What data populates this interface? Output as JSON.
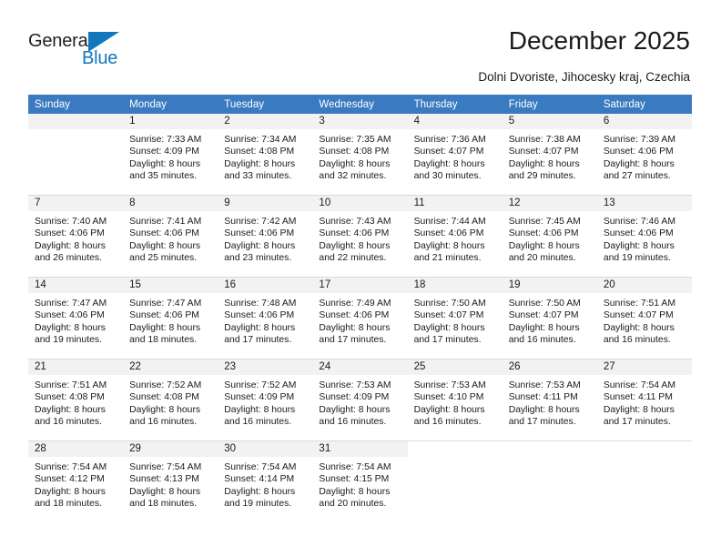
{
  "logo": {
    "text_top": "General",
    "text_bottom": "Blue",
    "accent_color": "#1277bd"
  },
  "header": {
    "title": "December 2025",
    "subtitle": "Dolni Dvoriste, Jihocesky kraj, Czechia"
  },
  "calendar": {
    "header_bg": "#3a7ac0",
    "daynum_bg": "#f2f2f2",
    "weekday_headers": [
      "Sunday",
      "Monday",
      "Tuesday",
      "Wednesday",
      "Thursday",
      "Friday",
      "Saturday"
    ],
    "weeks": [
      [
        {
          "day": "",
          "sunrise": "",
          "sunset": "",
          "daylight_line1": "",
          "daylight_line2": ""
        },
        {
          "day": "1",
          "sunrise": "Sunrise: 7:33 AM",
          "sunset": "Sunset: 4:09 PM",
          "daylight_line1": "Daylight: 8 hours",
          "daylight_line2": "and 35 minutes."
        },
        {
          "day": "2",
          "sunrise": "Sunrise: 7:34 AM",
          "sunset": "Sunset: 4:08 PM",
          "daylight_line1": "Daylight: 8 hours",
          "daylight_line2": "and 33 minutes."
        },
        {
          "day": "3",
          "sunrise": "Sunrise: 7:35 AM",
          "sunset": "Sunset: 4:08 PM",
          "daylight_line1": "Daylight: 8 hours",
          "daylight_line2": "and 32 minutes."
        },
        {
          "day": "4",
          "sunrise": "Sunrise: 7:36 AM",
          "sunset": "Sunset: 4:07 PM",
          "daylight_line1": "Daylight: 8 hours",
          "daylight_line2": "and 30 minutes."
        },
        {
          "day": "5",
          "sunrise": "Sunrise: 7:38 AM",
          "sunset": "Sunset: 4:07 PM",
          "daylight_line1": "Daylight: 8 hours",
          "daylight_line2": "and 29 minutes."
        },
        {
          "day": "6",
          "sunrise": "Sunrise: 7:39 AM",
          "sunset": "Sunset: 4:06 PM",
          "daylight_line1": "Daylight: 8 hours",
          "daylight_line2": "and 27 minutes."
        }
      ],
      [
        {
          "day": "7",
          "sunrise": "Sunrise: 7:40 AM",
          "sunset": "Sunset: 4:06 PM",
          "daylight_line1": "Daylight: 8 hours",
          "daylight_line2": "and 26 minutes."
        },
        {
          "day": "8",
          "sunrise": "Sunrise: 7:41 AM",
          "sunset": "Sunset: 4:06 PM",
          "daylight_line1": "Daylight: 8 hours",
          "daylight_line2": "and 25 minutes."
        },
        {
          "day": "9",
          "sunrise": "Sunrise: 7:42 AM",
          "sunset": "Sunset: 4:06 PM",
          "daylight_line1": "Daylight: 8 hours",
          "daylight_line2": "and 23 minutes."
        },
        {
          "day": "10",
          "sunrise": "Sunrise: 7:43 AM",
          "sunset": "Sunset: 4:06 PM",
          "daylight_line1": "Daylight: 8 hours",
          "daylight_line2": "and 22 minutes."
        },
        {
          "day": "11",
          "sunrise": "Sunrise: 7:44 AM",
          "sunset": "Sunset: 4:06 PM",
          "daylight_line1": "Daylight: 8 hours",
          "daylight_line2": "and 21 minutes."
        },
        {
          "day": "12",
          "sunrise": "Sunrise: 7:45 AM",
          "sunset": "Sunset: 4:06 PM",
          "daylight_line1": "Daylight: 8 hours",
          "daylight_line2": "and 20 minutes."
        },
        {
          "day": "13",
          "sunrise": "Sunrise: 7:46 AM",
          "sunset": "Sunset: 4:06 PM",
          "daylight_line1": "Daylight: 8 hours",
          "daylight_line2": "and 19 minutes."
        }
      ],
      [
        {
          "day": "14",
          "sunrise": "Sunrise: 7:47 AM",
          "sunset": "Sunset: 4:06 PM",
          "daylight_line1": "Daylight: 8 hours",
          "daylight_line2": "and 19 minutes."
        },
        {
          "day": "15",
          "sunrise": "Sunrise: 7:47 AM",
          "sunset": "Sunset: 4:06 PM",
          "daylight_line1": "Daylight: 8 hours",
          "daylight_line2": "and 18 minutes."
        },
        {
          "day": "16",
          "sunrise": "Sunrise: 7:48 AM",
          "sunset": "Sunset: 4:06 PM",
          "daylight_line1": "Daylight: 8 hours",
          "daylight_line2": "and 17 minutes."
        },
        {
          "day": "17",
          "sunrise": "Sunrise: 7:49 AM",
          "sunset": "Sunset: 4:06 PM",
          "daylight_line1": "Daylight: 8 hours",
          "daylight_line2": "and 17 minutes."
        },
        {
          "day": "18",
          "sunrise": "Sunrise: 7:50 AM",
          "sunset": "Sunset: 4:07 PM",
          "daylight_line1": "Daylight: 8 hours",
          "daylight_line2": "and 17 minutes."
        },
        {
          "day": "19",
          "sunrise": "Sunrise: 7:50 AM",
          "sunset": "Sunset: 4:07 PM",
          "daylight_line1": "Daylight: 8 hours",
          "daylight_line2": "and 16 minutes."
        },
        {
          "day": "20",
          "sunrise": "Sunrise: 7:51 AM",
          "sunset": "Sunset: 4:07 PM",
          "daylight_line1": "Daylight: 8 hours",
          "daylight_line2": "and 16 minutes."
        }
      ],
      [
        {
          "day": "21",
          "sunrise": "Sunrise: 7:51 AM",
          "sunset": "Sunset: 4:08 PM",
          "daylight_line1": "Daylight: 8 hours",
          "daylight_line2": "and 16 minutes."
        },
        {
          "day": "22",
          "sunrise": "Sunrise: 7:52 AM",
          "sunset": "Sunset: 4:08 PM",
          "daylight_line1": "Daylight: 8 hours",
          "daylight_line2": "and 16 minutes."
        },
        {
          "day": "23",
          "sunrise": "Sunrise: 7:52 AM",
          "sunset": "Sunset: 4:09 PM",
          "daylight_line1": "Daylight: 8 hours",
          "daylight_line2": "and 16 minutes."
        },
        {
          "day": "24",
          "sunrise": "Sunrise: 7:53 AM",
          "sunset": "Sunset: 4:09 PM",
          "daylight_line1": "Daylight: 8 hours",
          "daylight_line2": "and 16 minutes."
        },
        {
          "day": "25",
          "sunrise": "Sunrise: 7:53 AM",
          "sunset": "Sunset: 4:10 PM",
          "daylight_line1": "Daylight: 8 hours",
          "daylight_line2": "and 16 minutes."
        },
        {
          "day": "26",
          "sunrise": "Sunrise: 7:53 AM",
          "sunset": "Sunset: 4:11 PM",
          "daylight_line1": "Daylight: 8 hours",
          "daylight_line2": "and 17 minutes."
        },
        {
          "day": "27",
          "sunrise": "Sunrise: 7:54 AM",
          "sunset": "Sunset: 4:11 PM",
          "daylight_line1": "Daylight: 8 hours",
          "daylight_line2": "and 17 minutes."
        }
      ],
      [
        {
          "day": "28",
          "sunrise": "Sunrise: 7:54 AM",
          "sunset": "Sunset: 4:12 PM",
          "daylight_line1": "Daylight: 8 hours",
          "daylight_line2": "and 18 minutes."
        },
        {
          "day": "29",
          "sunrise": "Sunrise: 7:54 AM",
          "sunset": "Sunset: 4:13 PM",
          "daylight_line1": "Daylight: 8 hours",
          "daylight_line2": "and 18 minutes."
        },
        {
          "day": "30",
          "sunrise": "Sunrise: 7:54 AM",
          "sunset": "Sunset: 4:14 PM",
          "daylight_line1": "Daylight: 8 hours",
          "daylight_line2": "and 19 minutes."
        },
        {
          "day": "31",
          "sunrise": "Sunrise: 7:54 AM",
          "sunset": "Sunset: 4:15 PM",
          "daylight_line1": "Daylight: 8 hours",
          "daylight_line2": "and 20 minutes."
        },
        {
          "day": "",
          "sunrise": "",
          "sunset": "",
          "daylight_line1": "",
          "daylight_line2": ""
        },
        {
          "day": "",
          "sunrise": "",
          "sunset": "",
          "daylight_line1": "",
          "daylight_line2": ""
        },
        {
          "day": "",
          "sunrise": "",
          "sunset": "",
          "daylight_line1": "",
          "daylight_line2": ""
        }
      ]
    ]
  }
}
